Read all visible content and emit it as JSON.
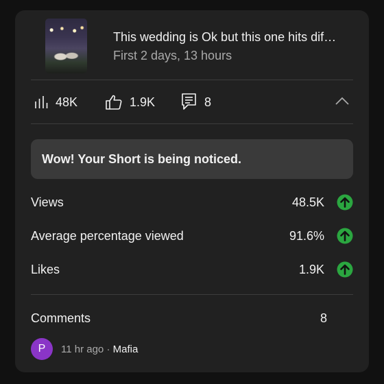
{
  "video": {
    "title": "This wedding is Ok but this one hits dif…",
    "period": "First 2 days, 13 hours"
  },
  "stats": {
    "views": "48K",
    "likes": "1.9K",
    "comments": "8"
  },
  "banner": "Wow! Your Short is being noticed.",
  "metrics": [
    {
      "label": "Views",
      "value": "48.5K"
    },
    {
      "label": "Average percentage viewed",
      "value": "91.6%"
    },
    {
      "label": "Likes",
      "value": "1.9K"
    }
  ],
  "comments_section": {
    "label": "Comments",
    "count": "8"
  },
  "latest_comment": {
    "avatar_letter": "P",
    "time": "11 hr ago",
    "separator": " · ",
    "author": "Mafia"
  },
  "colors": {
    "background": "#111111",
    "card": "#212121",
    "banner": "#3a3a3a",
    "trend_up": "#2ba640",
    "avatar": "#8a35c7"
  },
  "icons": [
    "bar-chart-icon",
    "thumbs-up-icon",
    "comment-icon",
    "chevron-up-icon",
    "trend-up-icon"
  ]
}
